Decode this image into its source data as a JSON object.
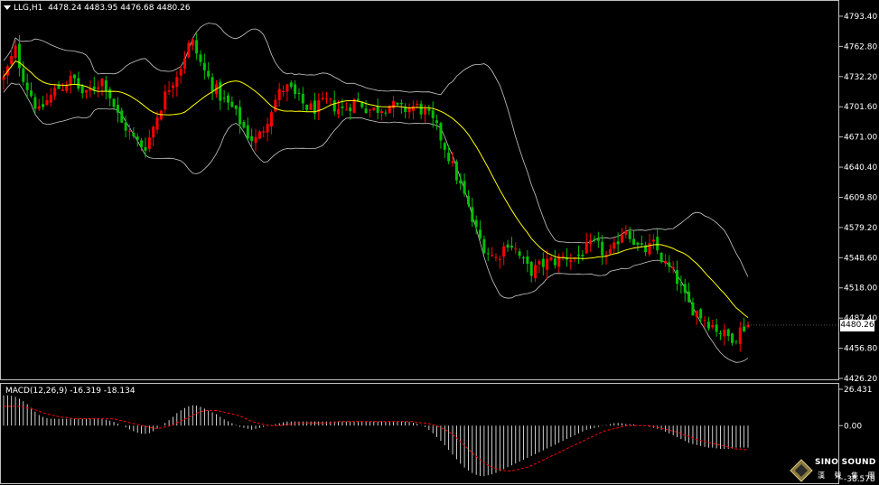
{
  "header": {
    "symbol_label": "LLG,H1",
    "ohlc": "4478.24 4483.95 4476.68 4480.26",
    "menu_icon": "triangle-down-icon"
  },
  "macd": {
    "label": "MACD(12,26,9)",
    "values": "-16.319 -18.134"
  },
  "price_axis": {
    "ticks": [
      "4793.40",
      "4762.80",
      "4732.20",
      "4701.60",
      "4671.00",
      "4640.40",
      "4609.80",
      "4579.20",
      "4548.60",
      "4518.00",
      "4487.40",
      "4456.80",
      "4426.20"
    ],
    "current": "4480.26"
  },
  "macd_axis": {
    "ticks": [
      "26.431",
      "0.00",
      "-38.578"
    ]
  },
  "logo": {
    "text_top": "SINO SOUND",
    "text_bottom": "漢 聲 集 團"
  },
  "colors": {
    "background": "#000000",
    "bull": "#ff0000",
    "bear": "#00c000",
    "ma": "#ffff00",
    "bands": "#c8c8c8",
    "signal": "#ff0000",
    "histogram": "#ffffff",
    "frame": "#c0c0c0"
  },
  "chart_data": {
    "type": "candlestick",
    "timeframe": "H1",
    "price_range": [
      4426.2,
      4808
    ],
    "close_path": [
      4730,
      4745,
      4760,
      4738,
      4722,
      4710,
      4695,
      4705,
      4712,
      4720,
      4722,
      4728,
      4730,
      4718,
      4712,
      4720,
      4725,
      4730,
      4715,
      4700,
      4685,
      4680,
      4670,
      4665,
      4660,
      4672,
      4690,
      4705,
      4720,
      4730,
      4740,
      4755,
      4770,
      4755,
      4740,
      4730,
      4720,
      4712,
      4705,
      4700,
      4690,
      4680,
      4670,
      4668,
      4675,
      4690,
      4705,
      4715,
      4722,
      4718,
      4710,
      4705,
      4700,
      4700,
      4702,
      4706,
      4704,
      4700,
      4698,
      4703,
      4708,
      4705,
      4700,
      4698,
      4700,
      4702,
      4704,
      4700,
      4698,
      4700,
      4702,
      4700,
      4695,
      4688,
      4678,
      4665,
      4650,
      4635,
      4620,
      4605,
      4585,
      4570,
      4560,
      4552,
      4548,
      4556,
      4565,
      4560,
      4550,
      4540,
      4535,
      4538,
      4542,
      4545,
      4545,
      4548,
      4550,
      4548,
      4550,
      4556,
      4560,
      4562,
      4556,
      4548,
      4555,
      4570,
      4580,
      4572,
      4560,
      4555,
      4558,
      4562,
      4550,
      4540,
      4535,
      4525,
      4510,
      4500,
      4495,
      4490,
      4485,
      4480,
      4475,
      4470,
      4468,
      4470,
      4478,
      4480
    ],
    "macd": {
      "range": [
        -38.578,
        26.431
      ],
      "histogram": [
        22,
        22,
        21,
        19,
        16,
        12,
        8,
        6,
        5,
        5,
        5,
        5,
        5,
        5,
        5,
        5,
        5,
        5,
        4,
        3,
        1,
        -1,
        -3,
        -5,
        -6,
        -6,
        -4,
        -1,
        2,
        5,
        9,
        12,
        14,
        15,
        14,
        12,
        10,
        8,
        5,
        3,
        1,
        -1,
        -2,
        -3,
        -2,
        -1,
        0,
        1,
        2,
        3,
        3,
        3,
        3,
        3,
        3,
        3,
        3,
        3,
        3,
        3,
        3,
        3,
        3,
        3,
        3,
        3,
        3,
        3,
        3,
        3,
        3,
        2,
        1,
        -1,
        -4,
        -8,
        -12,
        -17,
        -22,
        -27,
        -31,
        -34,
        -36,
        -37,
        -36,
        -35,
        -33,
        -31,
        -29,
        -27,
        -25,
        -23,
        -21,
        -19,
        -17,
        -15,
        -13,
        -11,
        -9,
        -7,
        -5,
        -3,
        -2,
        -1,
        0,
        1,
        2,
        2,
        1,
        1,
        0,
        0,
        -1,
        -2,
        -3,
        -5,
        -7,
        -9,
        -11,
        -13,
        -14,
        -15,
        -16,
        -16,
        -17,
        -17,
        -17,
        -16,
        -16,
        -16
      ],
      "signal": [
        14,
        14,
        14,
        14,
        13,
        12,
        11,
        9,
        8,
        7,
        6,
        6,
        5,
        5,
        5,
        5,
        5,
        5,
        5,
        5,
        4,
        3,
        2,
        1,
        0,
        -1,
        -2,
        -2,
        -1,
        0,
        2,
        4,
        6,
        8,
        10,
        11,
        11,
        11,
        10,
        9,
        8,
        7,
        5,
        3,
        2,
        1,
        0,
        0,
        0,
        1,
        1,
        2,
        2,
        2,
        2,
        2,
        2,
        2,
        3,
        3,
        3,
        3,
        3,
        3,
        3,
        3,
        3,
        3,
        3,
        3,
        3,
        3,
        2,
        2,
        1,
        0,
        -2,
        -4,
        -7,
        -11,
        -15,
        -19,
        -23,
        -26,
        -29,
        -31,
        -32,
        -33,
        -33,
        -32,
        -31,
        -30,
        -28,
        -26,
        -24,
        -22,
        -20,
        -18,
        -16,
        -14,
        -12,
        -10,
        -8,
        -6,
        -4,
        -3,
        -2,
        -1,
        0,
        0,
        0,
        0,
        0,
        -1,
        -2,
        -3,
        -4,
        -5,
        -7,
        -8,
        -10,
        -11,
        -12,
        -13,
        -14,
        -15,
        -16,
        -17,
        -17,
        -18,
        -18
      ]
    }
  }
}
